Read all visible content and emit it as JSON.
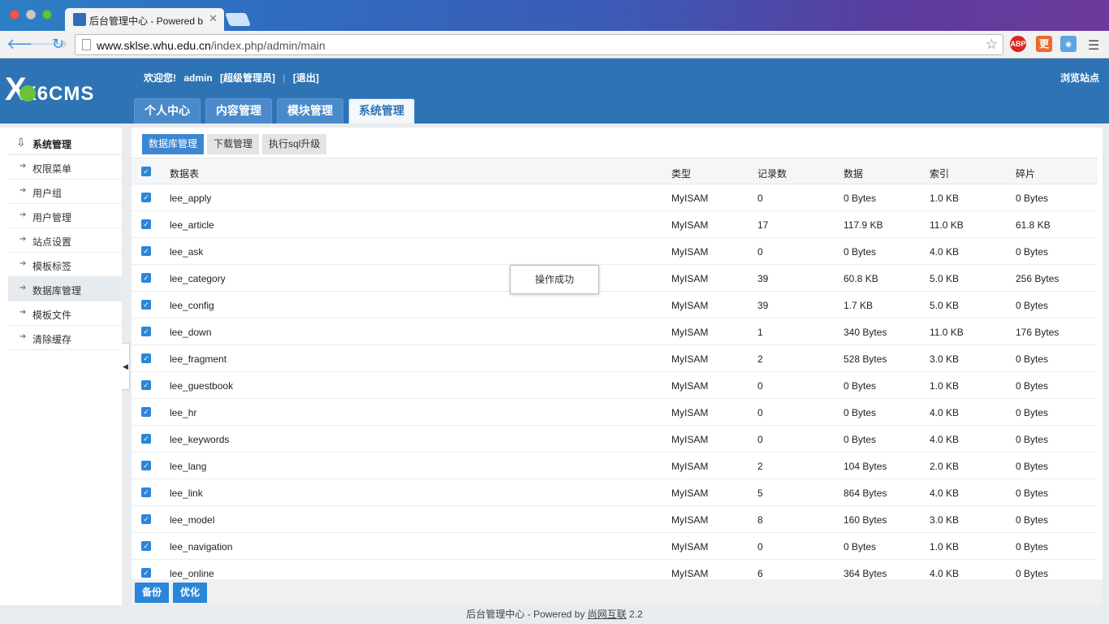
{
  "browser": {
    "tab_title": "后台管理中心 - Powered by",
    "url_host": "www.sklse.whu.edu.cn",
    "url_path": "/index.php/admin/main",
    "ext_abp": "ABP",
    "ext_2": "更"
  },
  "header": {
    "logo_text": "X6CMS",
    "welcome": "欢迎您!",
    "username": "admin",
    "role_link": "[超级管理员]",
    "logout_link": "[退出]",
    "browse_site": "浏览站点",
    "tabs": [
      {
        "label": "个人中心",
        "active": false
      },
      {
        "label": "内容管理",
        "active": false
      },
      {
        "label": "模块管理",
        "active": false
      },
      {
        "label": "系统管理",
        "active": true
      }
    ]
  },
  "sidebar": {
    "title": "系统管理",
    "items": [
      {
        "label": "权限菜单"
      },
      {
        "label": "用户组"
      },
      {
        "label": "用户管理"
      },
      {
        "label": "站点设置"
      },
      {
        "label": "模板标签"
      },
      {
        "label": "数据库管理",
        "active": true
      },
      {
        "label": "模板文件"
      },
      {
        "label": "清除缓存"
      }
    ]
  },
  "subtabs": [
    {
      "label": "数据库管理",
      "active": true
    },
    {
      "label": "下载管理"
    },
    {
      "label": "执行sql升级"
    }
  ],
  "table": {
    "columns": [
      "数据表",
      "类型",
      "记录数",
      "数据",
      "索引",
      "碎片"
    ],
    "rows": [
      {
        "name": "lee_apply",
        "type": "MyISAM",
        "rows": "0",
        "data": "0 Bytes",
        "index": "1.0 KB",
        "frag": "0 Bytes"
      },
      {
        "name": "lee_article",
        "type": "MyISAM",
        "rows": "17",
        "data": "117.9 KB",
        "index": "11.0 KB",
        "frag": "61.8 KB"
      },
      {
        "name": "lee_ask",
        "type": "MyISAM",
        "rows": "0",
        "data": "0 Bytes",
        "index": "4.0 KB",
        "frag": "0 Bytes"
      },
      {
        "name": "lee_category",
        "type": "MyISAM",
        "rows": "39",
        "data": "60.8 KB",
        "index": "5.0 KB",
        "frag": "256 Bytes"
      },
      {
        "name": "lee_config",
        "type": "MyISAM",
        "rows": "39",
        "data": "1.7 KB",
        "index": "5.0 KB",
        "frag": "0 Bytes"
      },
      {
        "name": "lee_down",
        "type": "MyISAM",
        "rows": "1",
        "data": "340 Bytes",
        "index": "11.0 KB",
        "frag": "176 Bytes"
      },
      {
        "name": "lee_fragment",
        "type": "MyISAM",
        "rows": "2",
        "data": "528 Bytes",
        "index": "3.0 KB",
        "frag": "0 Bytes"
      },
      {
        "name": "lee_guestbook",
        "type": "MyISAM",
        "rows": "0",
        "data": "0 Bytes",
        "index": "1.0 KB",
        "frag": "0 Bytes"
      },
      {
        "name": "lee_hr",
        "type": "MyISAM",
        "rows": "0",
        "data": "0 Bytes",
        "index": "4.0 KB",
        "frag": "0 Bytes"
      },
      {
        "name": "lee_keywords",
        "type": "MyISAM",
        "rows": "0",
        "data": "0 Bytes",
        "index": "4.0 KB",
        "frag": "0 Bytes"
      },
      {
        "name": "lee_lang",
        "type": "MyISAM",
        "rows": "2",
        "data": "104 Bytes",
        "index": "2.0 KB",
        "frag": "0 Bytes"
      },
      {
        "name": "lee_link",
        "type": "MyISAM",
        "rows": "5",
        "data": "864 Bytes",
        "index": "4.0 KB",
        "frag": "0 Bytes"
      },
      {
        "name": "lee_model",
        "type": "MyISAM",
        "rows": "8",
        "data": "160 Bytes",
        "index": "3.0 KB",
        "frag": "0 Bytes"
      },
      {
        "name": "lee_navigation",
        "type": "MyISAM",
        "rows": "0",
        "data": "0 Bytes",
        "index": "1.0 KB",
        "frag": "0 Bytes"
      },
      {
        "name": "lee_online",
        "type": "MyISAM",
        "rows": "6",
        "data": "364 Bytes",
        "index": "4.0 KB",
        "frag": "0 Bytes"
      }
    ]
  },
  "toast": "操作成功",
  "buttons": {
    "backup": "备份",
    "optimize": "优化"
  },
  "footer": {
    "prefix": "后台管理中心 - Powered by ",
    "link": "尚网互联",
    "version": " 2.2"
  }
}
